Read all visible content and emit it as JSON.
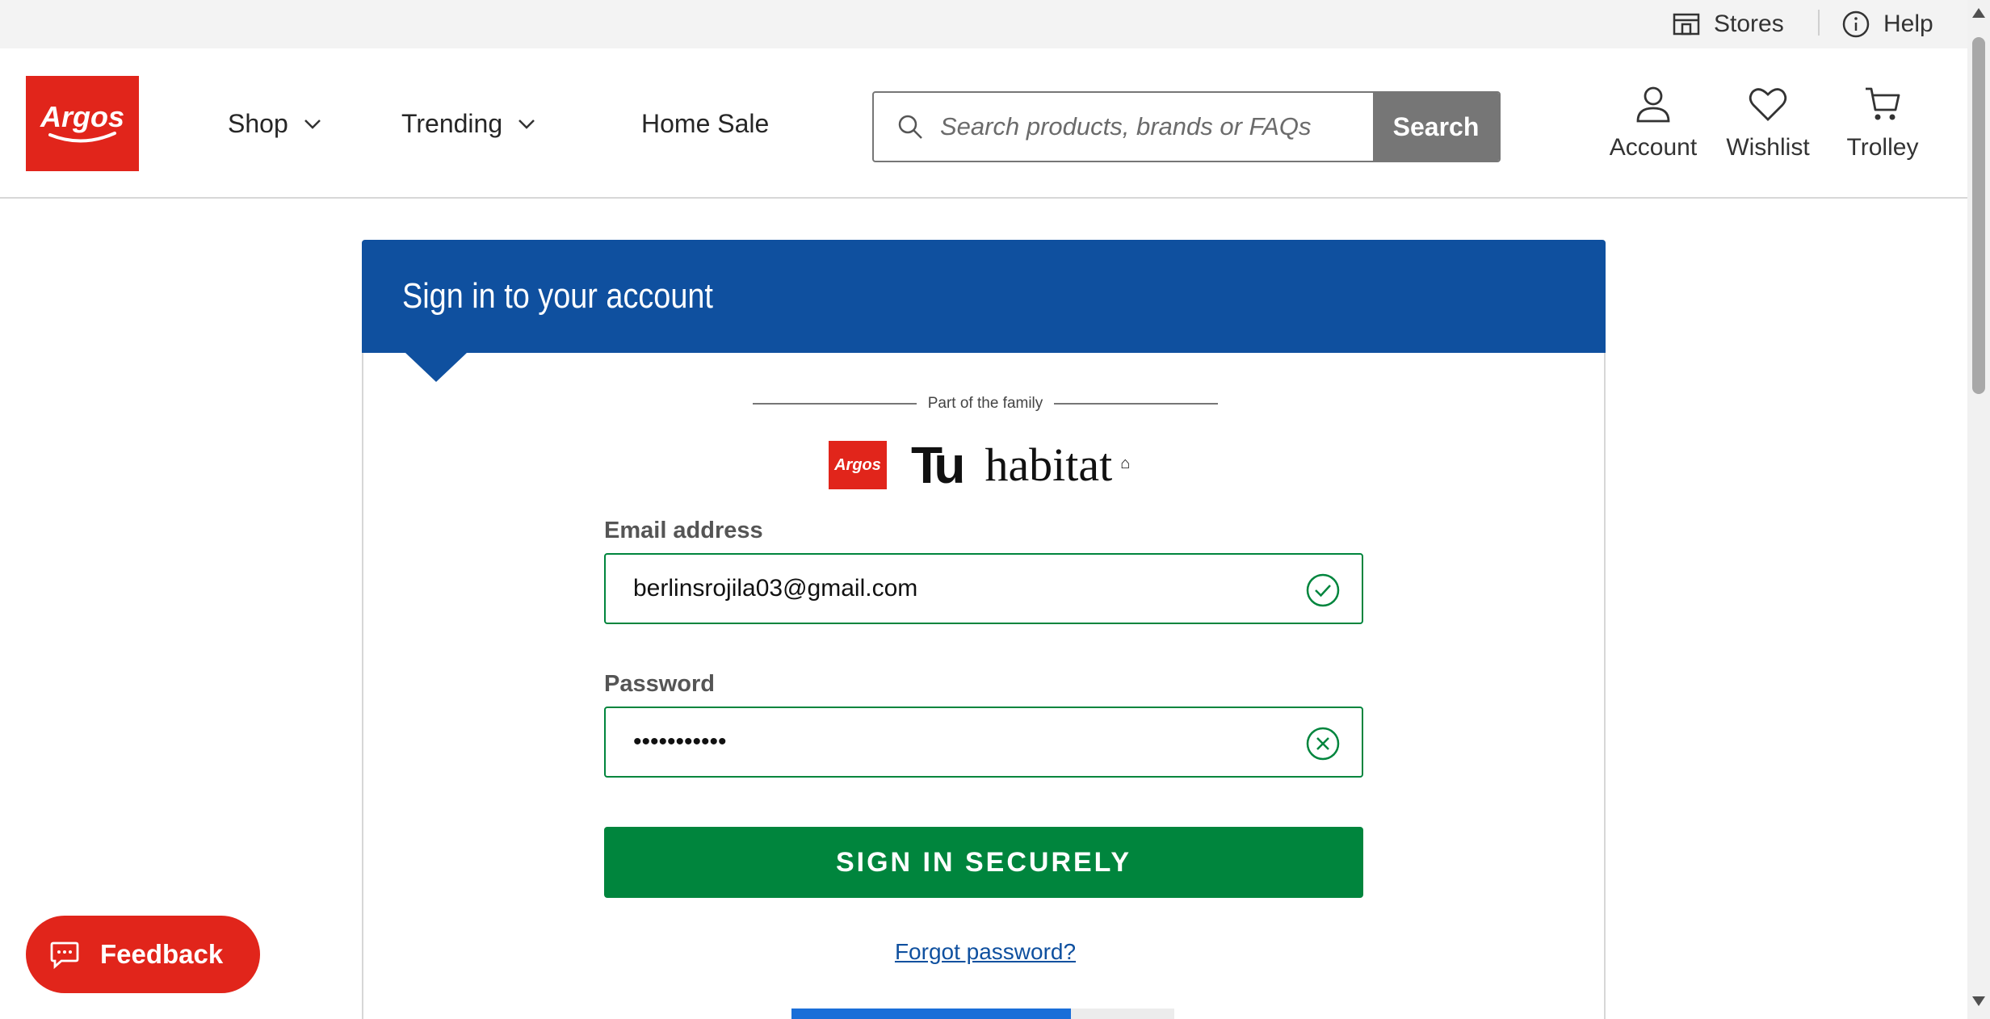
{
  "utility": {
    "stores_label": "Stores",
    "help_label": "Help"
  },
  "header": {
    "logo_text": "Argos",
    "nav": {
      "shop": "Shop",
      "trending": "Trending",
      "home_sale": "Home Sale"
    },
    "search": {
      "placeholder": "Search products, brands or FAQs",
      "button_label": "Search"
    },
    "account_label": "Account",
    "wishlist_label": "Wishlist",
    "trolley_label": "Trolley"
  },
  "signin": {
    "title": "Sign in to your account",
    "family_label": "Part of the family",
    "brands": {
      "argos": "Argos",
      "tu": "Tu",
      "habitat": "habitat"
    },
    "email_label": "Email address",
    "email_value": "berlinsrojila03@gmail.com",
    "password_label": "Password",
    "password_value": "•••••••••••",
    "submit_label": "SIGN IN SECURELY",
    "forgot_label": "Forgot password?"
  },
  "feedback_label": "Feedback",
  "colors": {
    "brand_red": "#e1251b",
    "header_blue": "#0f509f",
    "success_green": "#00853d",
    "search_grey": "#767676"
  }
}
